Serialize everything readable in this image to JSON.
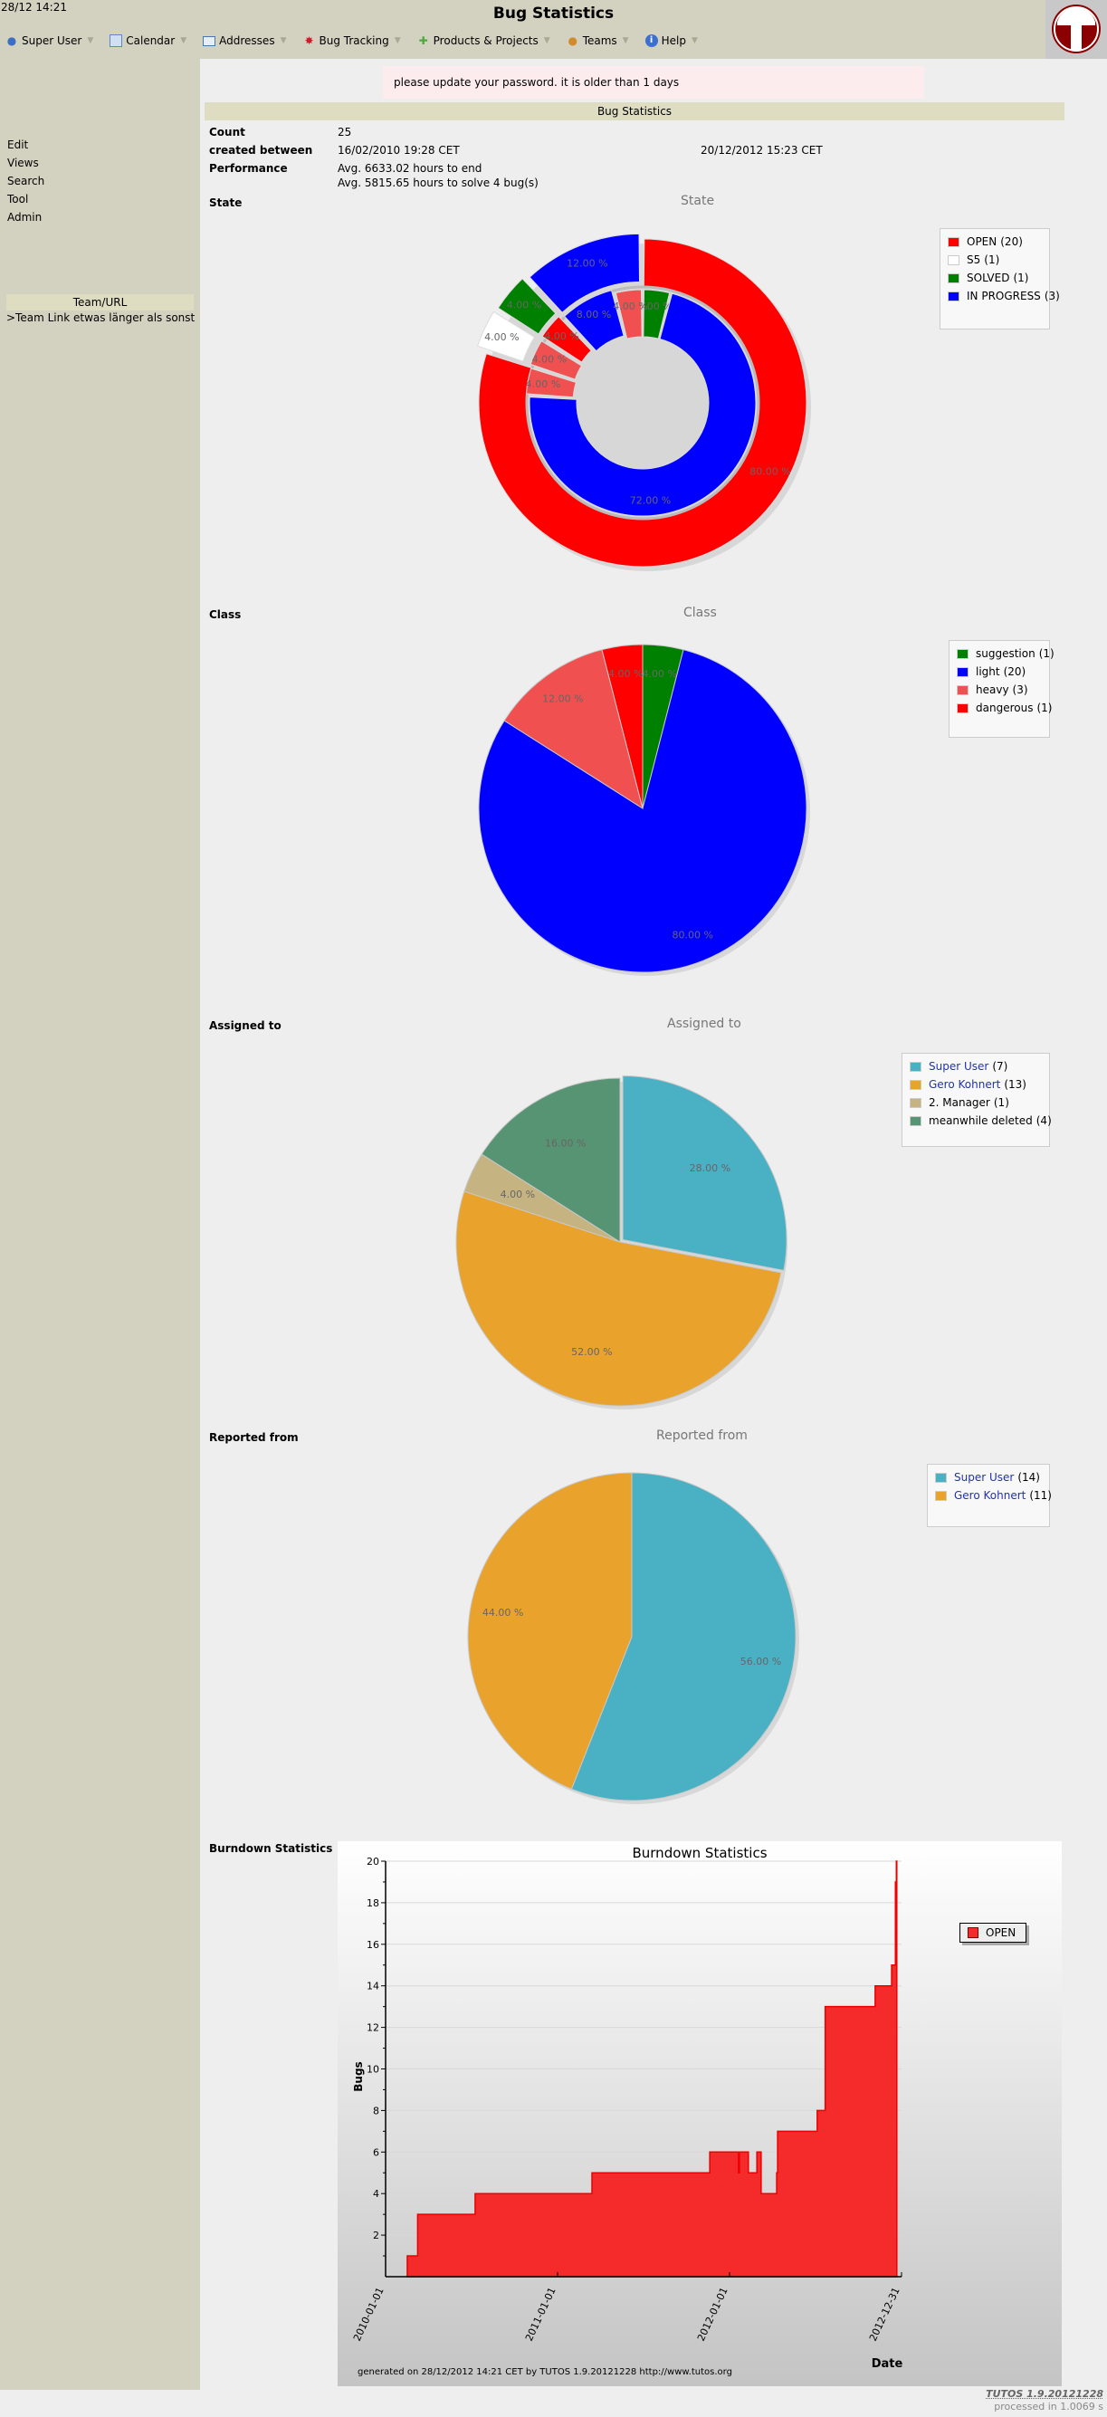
{
  "header": {
    "clock": "28/12 14:21",
    "title": "Bug Statistics",
    "menu": [
      {
        "label": "Super User",
        "icon": "user-icon"
      },
      {
        "label": "Calendar",
        "icon": "calendar-icon"
      },
      {
        "label": "Addresses",
        "icon": "address-card-icon"
      },
      {
        "label": "Bug Tracking",
        "icon": "bug-icon"
      },
      {
        "label": "Products & Projects",
        "icon": "puzzle-icon"
      },
      {
        "label": "Teams",
        "icon": "team-icon"
      },
      {
        "label": "Help",
        "icon": "info-icon"
      }
    ],
    "logo_letter": "T"
  },
  "sidebar": {
    "links": [
      "Edit",
      "Views",
      "Search",
      "Tool",
      "Admin"
    ],
    "team_header": "Team/URL",
    "team_link": ">Team Link etwas länger als sonst"
  },
  "warning": "please update your password. it is older than 1 days",
  "stats": {
    "header": "Bug Statistics",
    "count_label": "Count",
    "count_value": "25",
    "created_label": "created between",
    "created_from": "16/02/2010 19:28 CET",
    "created_to": "20/12/2012 15:23 CET",
    "performance_label": "Performance",
    "performance_line1": "Avg. 6633.02 hours to end",
    "performance_line2": "Avg. 5815.65 hours to solve 4 bug(s)"
  },
  "sections": {
    "state": "State",
    "class": "Class",
    "assigned": "Assigned to",
    "reported": "Reported from",
    "burndown": "Burndown Statistics"
  },
  "chart_data": [
    {
      "type": "pie",
      "variant": "double-donut",
      "title": "State",
      "legend": [
        {
          "label": "OPEN",
          "count": "(20)",
          "color": "#ff0000"
        },
        {
          "label": "S5",
          "count": "(1)",
          "color": "#ffffff"
        },
        {
          "label": "SOLVED",
          "count": "(1)",
          "color": "#008000"
        },
        {
          "label": "IN PROGRESS",
          "count": "(3)",
          "color": "#0000ff"
        }
      ],
      "outer_ring": [
        {
          "label": "OPEN",
          "value": 80,
          "text": "80.00 %",
          "color": "#ff0000"
        },
        {
          "label": "S5",
          "value": 4,
          "text": "4.00 %",
          "color": "#ffffff"
        },
        {
          "label": "SOLVED",
          "value": 4,
          "text": "4.00 %",
          "color": "#008000"
        },
        {
          "label": "IN PROGRESS",
          "value": 12,
          "text": "12.00 %",
          "color": "#0000ff"
        }
      ],
      "inner_ring": [
        {
          "label": "suggestion",
          "value": 4,
          "text": "4.00 %",
          "color": "#008000"
        },
        {
          "label": "light",
          "value": 72,
          "text": "72.00 %",
          "color": "#0000ff"
        },
        {
          "label": "heavy",
          "value": 4,
          "text": "4.00 %",
          "color": "#f05050"
        },
        {
          "label": "heavy",
          "value": 4,
          "text": "4.00 %",
          "color": "#f05050"
        },
        {
          "label": "dangerous",
          "value": 4,
          "text": "4.00 %",
          "color": "#ff0000"
        },
        {
          "label": "light",
          "value": 8,
          "text": "8.00 %",
          "color": "#0000ff"
        },
        {
          "label": "heavy",
          "value": 4,
          "text": "4.00 %",
          "color": "#f05050"
        }
      ]
    },
    {
      "type": "pie",
      "title": "Class",
      "legend": [
        {
          "label": "suggestion",
          "count": "(1)",
          "color": "#008000"
        },
        {
          "label": "light",
          "count": "(20)",
          "color": "#0000ff"
        },
        {
          "label": "heavy",
          "count": "(3)",
          "color": "#f05050"
        },
        {
          "label": "dangerous",
          "count": "(1)",
          "color": "#ff0000"
        }
      ],
      "slices": [
        {
          "label": "suggestion",
          "value": 4,
          "text": "4.00 %",
          "color": "#008000"
        },
        {
          "label": "light",
          "value": 80,
          "text": "80.00 %",
          "color": "#0000ff"
        },
        {
          "label": "heavy",
          "value": 12,
          "text": "12.00 %",
          "color": "#f05050"
        },
        {
          "label": "dangerous",
          "value": 4,
          "text": "4.00 %",
          "color": "#ff0000"
        }
      ]
    },
    {
      "type": "pie",
      "title": "Assigned to",
      "legend": [
        {
          "label": "Super User",
          "count": "(7)",
          "color": "#4ab0c4",
          "link": true
        },
        {
          "label": "Gero Kohnert",
          "count": "(13)",
          "color": "#e9a22b",
          "link": true
        },
        {
          "label": "2. Manager",
          "count": "(1)",
          "color": "#c5b481",
          "link": false
        },
        {
          "label": "meanwhile deleted",
          "count": "(4)",
          "color": "#579473",
          "link": false
        }
      ],
      "slices": [
        {
          "label": "Super User",
          "value": 28,
          "text": "28.00 %",
          "color": "#4ab0c4"
        },
        {
          "label": "Gero Kohnert",
          "value": 52,
          "text": "52.00 %",
          "color": "#e9a22b"
        },
        {
          "label": "2. Manager",
          "value": 4,
          "text": "4.00 %",
          "color": "#c5b481"
        },
        {
          "label": "meanwhile deleted",
          "value": 16,
          "text": "16.00 %",
          "color": "#579473"
        }
      ]
    },
    {
      "type": "pie",
      "title": "Reported from",
      "legend": [
        {
          "label": "Super User",
          "count": "(14)",
          "color": "#4ab0c4",
          "link": true
        },
        {
          "label": "Gero Kohnert",
          "count": "(11)",
          "color": "#e9a22b",
          "link": true
        }
      ],
      "slices": [
        {
          "label": "Super User",
          "value": 56,
          "text": "56.00 %",
          "color": "#4ab0c4"
        },
        {
          "label": "Gero Kohnert",
          "value": 44,
          "text": "44.00 %",
          "color": "#e9a22b"
        }
      ]
    },
    {
      "type": "area",
      "step": true,
      "title": "Burndown Statistics",
      "xlabel": "Date",
      "ylabel": "Bugs",
      "ylim": [
        0,
        20
      ],
      "yticks": [
        2,
        4,
        6,
        8,
        10,
        12,
        14,
        16,
        18,
        20
      ],
      "xticks": [
        "2010-01-01",
        "2011-01-01",
        "2012-01-01",
        "2012-12-31"
      ],
      "xlim": [
        "2010-01-01",
        "2012-12-31"
      ],
      "legend": [
        {
          "label": "OPEN",
          "color": "#f52a2a"
        }
      ],
      "footer": "generated on 28/12/2012 14:21 CET by TUTOS 1.9.20121228 http://www.tutos.org",
      "series": [
        {
          "name": "OPEN",
          "points": [
            [
              "2010-02-16",
              1
            ],
            [
              "2010-03-10",
              3
            ],
            [
              "2010-07-10",
              4
            ],
            [
              "2011-03-15",
              5
            ],
            [
              "2011-11-20",
              6
            ],
            [
              "2012-01-20",
              5
            ],
            [
              "2012-01-22",
              6
            ],
            [
              "2012-02-10",
              5
            ],
            [
              "2012-02-28",
              6
            ],
            [
              "2012-03-08",
              4
            ],
            [
              "2012-04-10",
              5
            ],
            [
              "2012-04-12",
              7
            ],
            [
              "2012-07-05",
              8
            ],
            [
              "2012-07-22",
              13
            ],
            [
              "2012-11-05",
              14
            ],
            [
              "2012-12-10",
              15
            ],
            [
              "2012-12-18",
              19
            ],
            [
              "2012-12-20",
              20
            ]
          ],
          "end": "2012-12-21"
        }
      ]
    }
  ],
  "footer": {
    "version": "TUTOS 1.9.20121228",
    "processed": "processed in 1.0069 s"
  }
}
